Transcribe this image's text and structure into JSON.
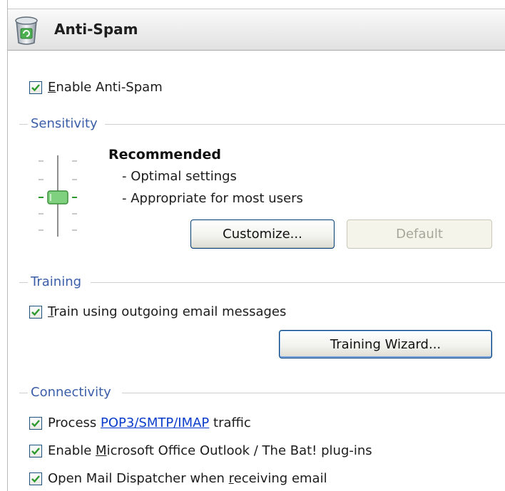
{
  "header": {
    "title": "Anti-Spam",
    "icon": "anti-spam-bin-icon"
  },
  "enable": {
    "label_key": "E",
    "label_rest": "nable Anti-Spam",
    "checked": true
  },
  "sensitivity": {
    "group_label": "Sensitivity",
    "level_title": "Recommended",
    "bullets": [
      "- Optimal settings",
      "- Appropriate for most users"
    ],
    "slider_level": "2 of 4 (Recommended)",
    "customize_button": "Customize...",
    "default_button": "Default"
  },
  "training": {
    "group_label": "Training",
    "train_key": "T",
    "train_rest": "rain using outgoing email messages",
    "train_checked": true,
    "wizard_button": "Training Wizard..."
  },
  "connectivity": {
    "group_label": "Connectivity",
    "process_before": "Process ",
    "process_link": "POP3/SMTP/IMAP",
    "process_after": " traffic",
    "process_checked": true,
    "plugins_before": "Enable ",
    "plugins_key": "M",
    "plugins_after": "icrosoft Office Outlook / The Bat! plug-ins",
    "plugins_checked": true,
    "dispatcher_before": "Open Mail Dispatcher when ",
    "dispatcher_key": "r",
    "dispatcher_after": "eceiving email",
    "dispatcher_checked": true
  },
  "colors": {
    "accent": "#3b5ea8",
    "check": "#2d9a2d",
    "link": "#0a3ccc",
    "checkbox_border": "#1c5180"
  }
}
